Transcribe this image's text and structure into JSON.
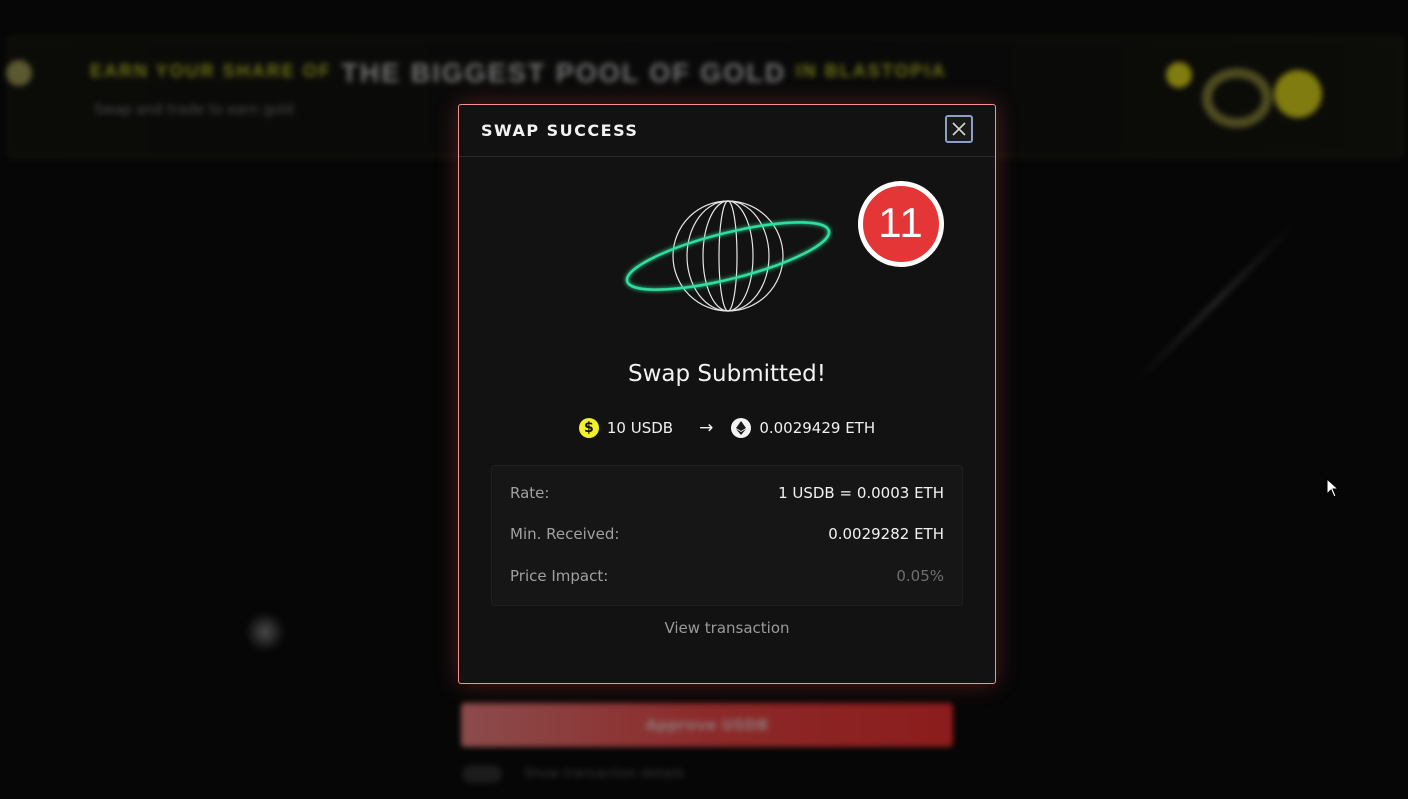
{
  "background": {
    "banner": {
      "prefix": "EARN YOUR SHARE OF",
      "headline": "THE BIGGEST POOL OF GOLD",
      "suffix": "IN BLASTOPIA",
      "subtitle": "Swap and trade to earn gold"
    },
    "cta_label": "Approve USDB",
    "footer_text": "Show transaction details"
  },
  "modal": {
    "title": "SWAP SUCCESS",
    "close_icon": "close-icon",
    "step_badge": "11",
    "heading": "Swap Submitted!",
    "swap": {
      "from_amount": "10 USDB",
      "from_icon": "usdb-token-icon",
      "arrow_icon": "arrow-right-icon",
      "to_amount": "0.0029429 ETH",
      "to_icon": "eth-token-icon"
    },
    "details": [
      {
        "label": "Rate:",
        "value": "1 USDB = 0.0003 ETH"
      },
      {
        "label": "Min. Received:",
        "value": "0.0029282 ETH"
      },
      {
        "label": "Price Impact:",
        "value": "0.05%"
      }
    ],
    "view_transaction": "View transaction"
  },
  "colors": {
    "accent_border": "#f09292",
    "badge_red": "#e43636",
    "usdb_yellow": "#f3ef2a",
    "ring_green": "#2fe0a0",
    "cta_red": "#ff4d4d"
  }
}
